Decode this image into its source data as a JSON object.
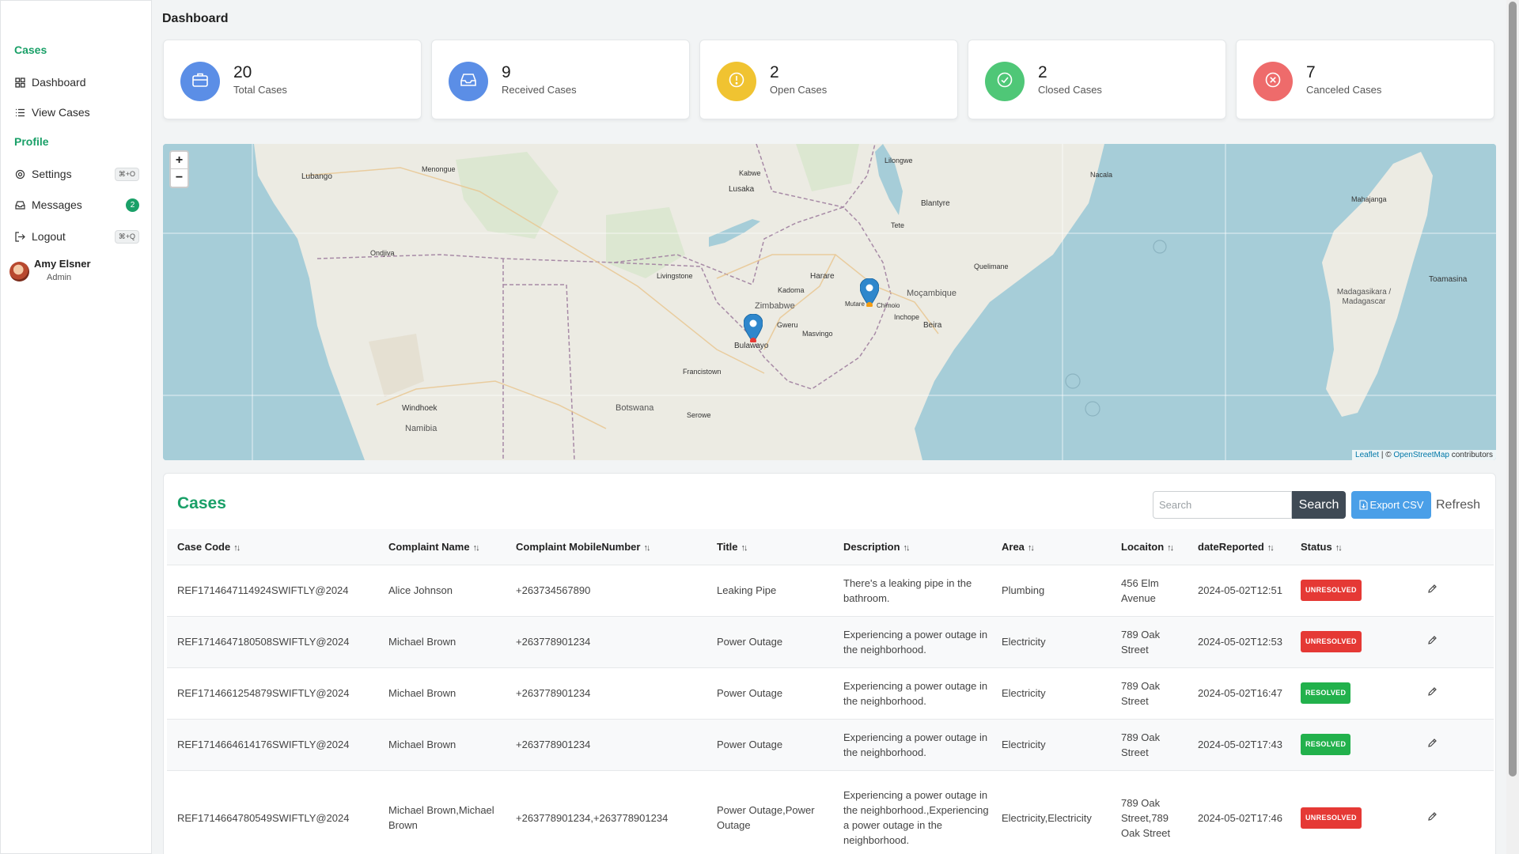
{
  "sidebar": {
    "section_cases": "Cases",
    "dashboard": "Dashboard",
    "view_cases": "View Cases",
    "section_profile": "Profile",
    "settings": "Settings",
    "settings_kbd": "⌘+O",
    "messages": "Messages",
    "messages_count": "2",
    "logout": "Logout",
    "logout_kbd": "⌘+Q",
    "user_name": "Amy Elsner",
    "user_role": "Admin"
  },
  "page_title": "Dashboard",
  "stats": [
    {
      "value": "20",
      "label": "Total Cases",
      "color": "#5b8ee6",
      "icon": "briefcase-icon"
    },
    {
      "value": "9",
      "label": "Received Cases",
      "color": "#5b8ee6",
      "icon": "inbox-icon"
    },
    {
      "value": "2",
      "label": "Open Cases",
      "color": "#f0c331",
      "icon": "exclamation-circle-icon"
    },
    {
      "value": "2",
      "label": "Closed Cases",
      "color": "#4fc777",
      "icon": "check-circle-icon"
    },
    {
      "value": "7",
      "label": "Canceled Cases",
      "color": "#ee6b6b",
      "icon": "times-circle-icon"
    }
  ],
  "map": {
    "zoom_in": "+",
    "zoom_out": "−",
    "attribution_leaflet": "Leaflet",
    "attribution_osm": "OpenStreetMap",
    "attribution_suffix": "contributors",
    "labels": {
      "lubango": "Lubango",
      "menongue": "Menongue",
      "ondjiva": "Ondjiva",
      "windhoek": "Windhoek",
      "namibia": "Namibia",
      "botswana": "Botswana",
      "lusaka": "Lusaka",
      "kabwe": "Kabwe",
      "zimbabwe": "Zimbabwe",
      "harare": "Harare",
      "bulawayo": "Bulawayo",
      "mutare": "Mutare",
      "gweru": "Gweru",
      "kadoma": "Kadoma",
      "masvingo": "Masvingo",
      "francistown": "Francistown",
      "livingstone": "Livingstone",
      "mocambique": "Moçambique",
      "beira": "Beira",
      "chimoio": "Chimoio",
      "inchope": "Inchope",
      "blantyre": "Blantyre",
      "lilongwe": "Lilongwe",
      "tete": "Tete",
      "quelimane": "Quelimane",
      "nacala": "Nacala",
      "mahajanga": "Mahajanga",
      "toamasina": "Toamasina",
      "madagasikara": "Madagasikara / Madagascar",
      "serowe": "Serowe"
    }
  },
  "cases": {
    "title": "Cases",
    "search_placeholder": "Search",
    "search_button": "Search",
    "export_button": "Export CSV",
    "refresh_button": "Refresh",
    "columns": [
      "Case Code",
      "Complaint Name",
      "Complaint MobileNumber",
      "Title",
      "Description",
      "Area",
      "Locaiton",
      "dateReported",
      "Status"
    ],
    "rows": [
      {
        "code": "REF1714647114924SWIFTLY@2024",
        "name": "Alice Johnson",
        "mobile": "+263734567890",
        "title": "Leaking Pipe",
        "description": "There's a leaking pipe in the bathroom.",
        "area": "Plumbing",
        "location": "456 Elm Avenue",
        "date": "2024-05-02T12:51",
        "status": "UNRESOLVED"
      },
      {
        "code": "REF1714647180508SWIFTLY@2024",
        "name": "Michael Brown",
        "mobile": "+263778901234",
        "title": "Power Outage",
        "description": "Experiencing a power outage in the neighborhood.",
        "area": "Electricity",
        "location": "789 Oak Street",
        "date": "2024-05-02T12:53",
        "status": "UNRESOLVED"
      },
      {
        "code": "REF1714661254879SWIFTLY@2024",
        "name": "Michael Brown",
        "mobile": "+263778901234",
        "title": "Power Outage",
        "description": "Experiencing a power outage in the neighborhood.",
        "area": "Electricity",
        "location": "789 Oak Street",
        "date": "2024-05-02T16:47",
        "status": "RESOLVED"
      },
      {
        "code": "REF1714664614176SWIFTLY@2024",
        "name": "Michael Brown",
        "mobile": "+263778901234",
        "title": "Power Outage",
        "description": "Experiencing a power outage in the neighborhood.",
        "area": "Electricity",
        "location": "789 Oak Street",
        "date": "2024-05-02T17:43",
        "status": "RESOLVED"
      },
      {
        "code": "REF1714664780549SWIFTLY@2024",
        "name": "Michael Brown,Michael Brown",
        "mobile": "+263778901234,+263778901234",
        "title": "Power Outage,Power Outage",
        "description": "Experiencing a power outage in the neighborhood.,Experiencing a power outage in the neighborhood.",
        "area": "Electricity,Electricity",
        "location": "789 Oak Street,789 Oak Street",
        "date": "2024-05-02T17:46",
        "status": "UNRESOLVED"
      }
    ],
    "status_colors": {
      "UNRESOLVED": "#e53935",
      "RESOLVED": "#22b14c"
    }
  }
}
